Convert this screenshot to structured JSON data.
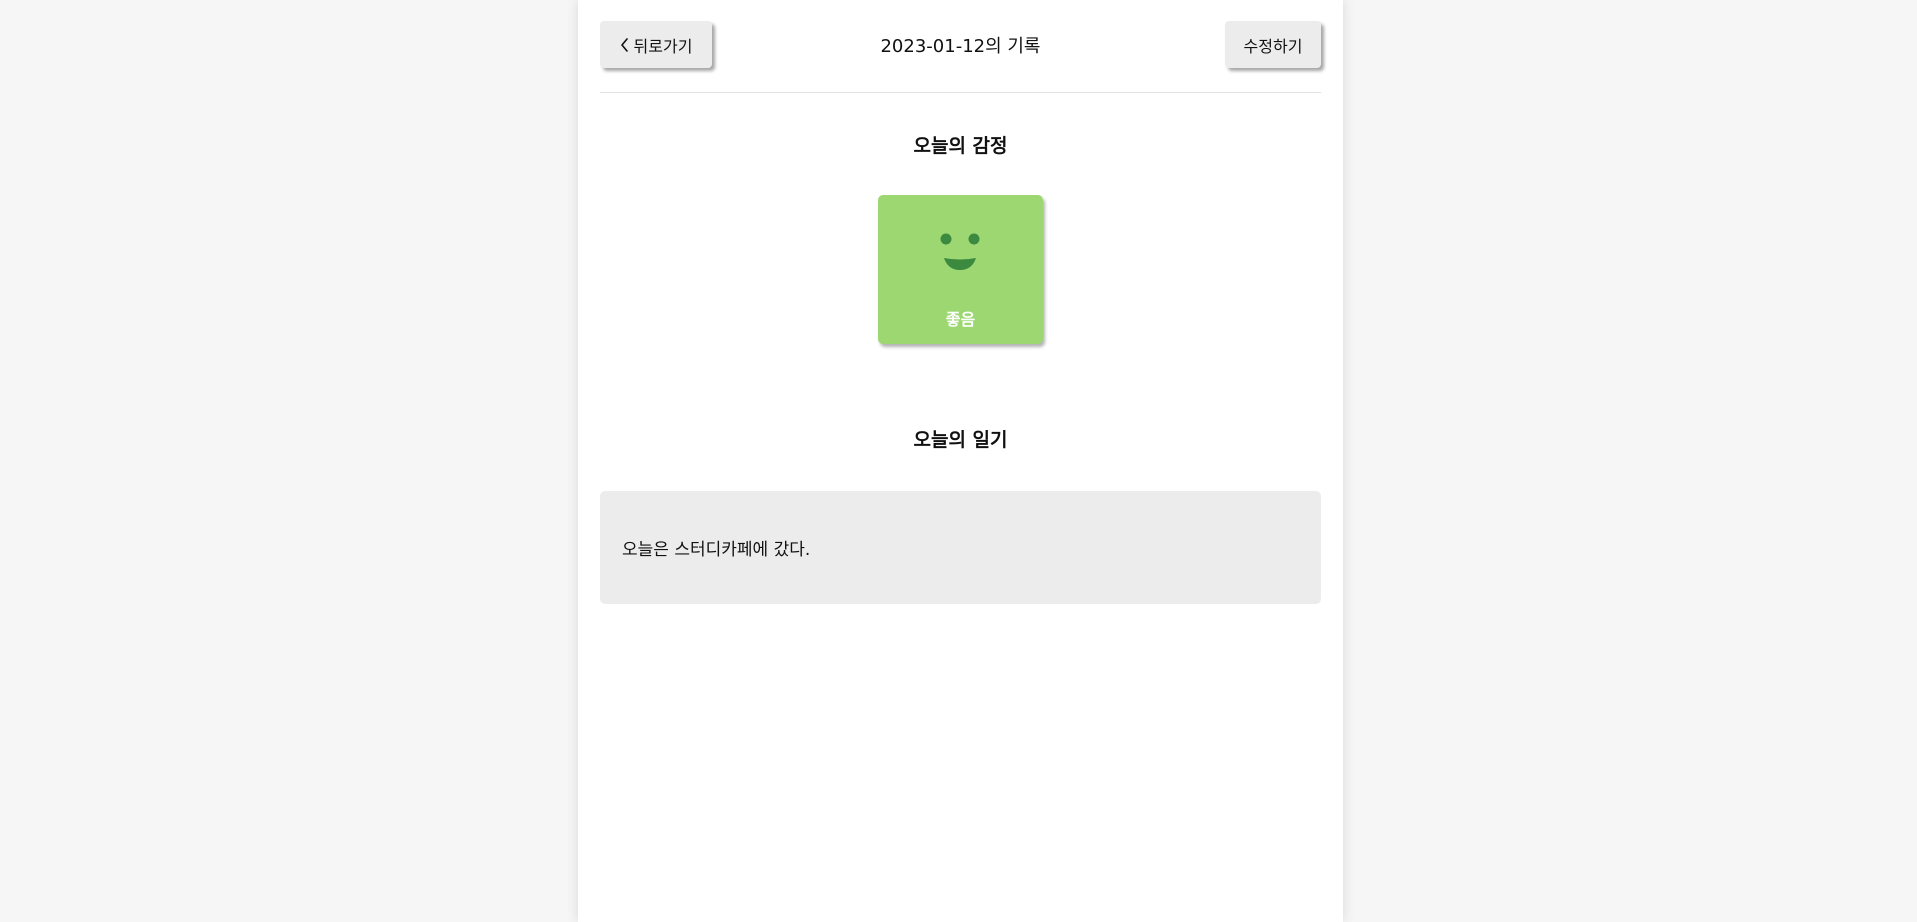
{
  "header": {
    "back_label": "뒤로가기",
    "title": "2023-01-12의 기록",
    "edit_label": "수정하기"
  },
  "emotion": {
    "section_title": "오늘의 감정",
    "label": "좋음",
    "face_icon": "smile-face-icon",
    "card_color": "#9dd772",
    "face_color": "#3c8a3f"
  },
  "diary": {
    "section_title": "오늘의 일기",
    "content": "오늘은 스터디카페에 갔다."
  }
}
